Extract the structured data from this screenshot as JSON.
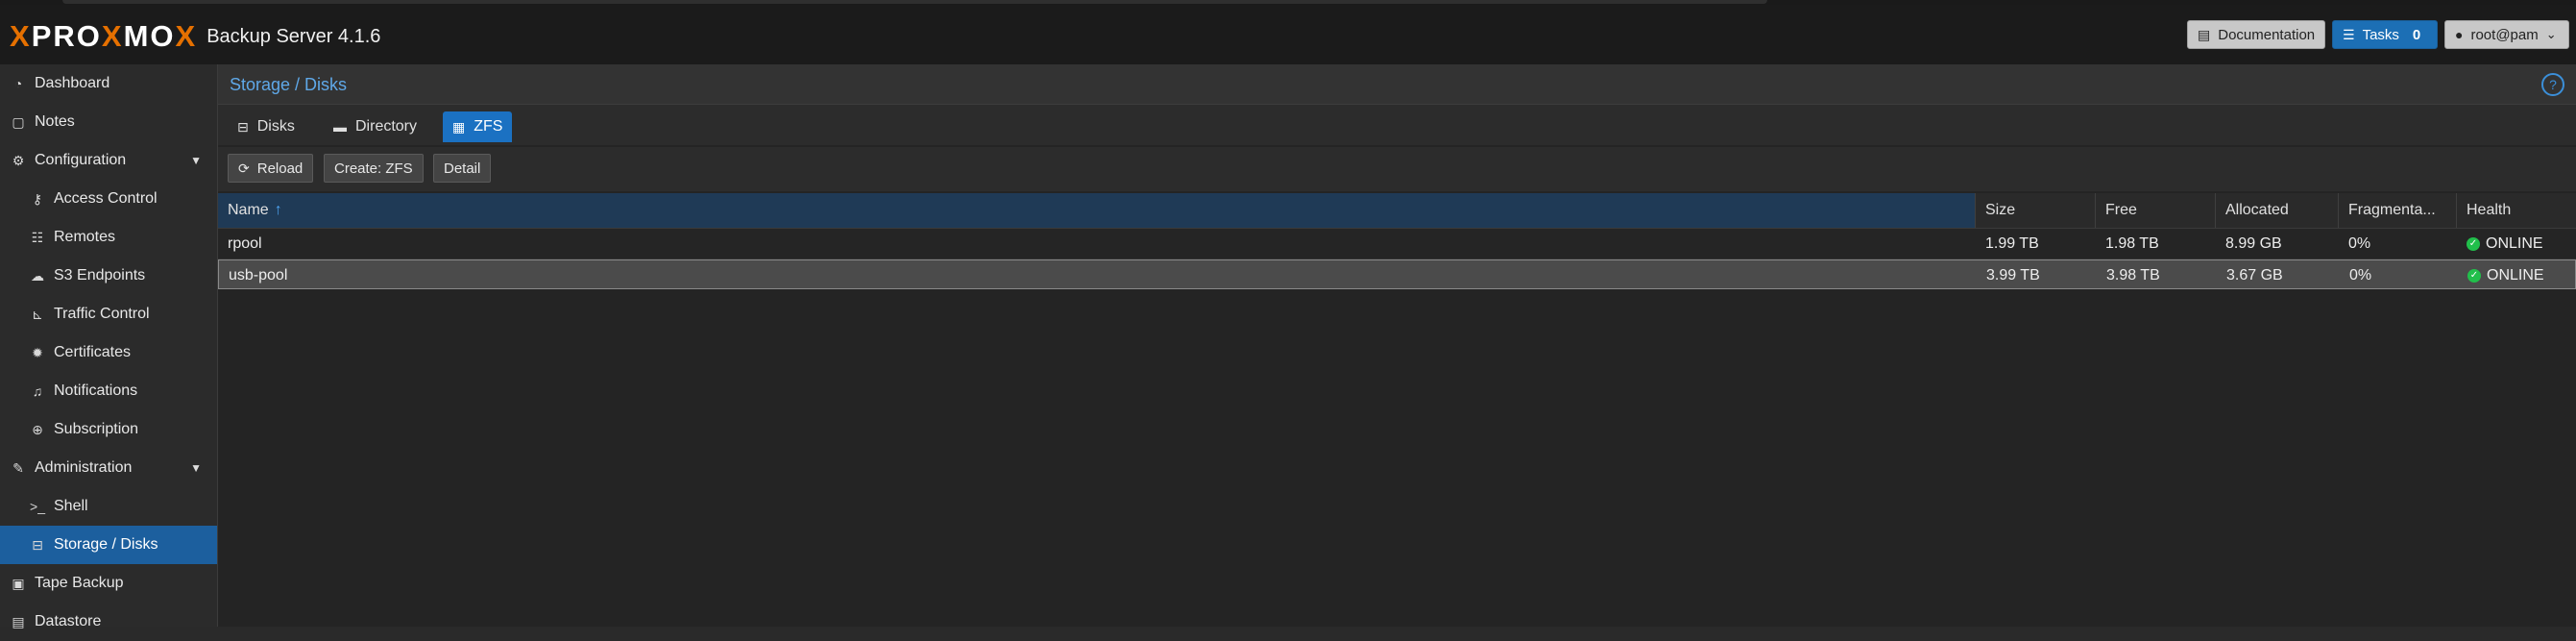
{
  "header": {
    "brand": "PROXMOX",
    "product": "Backup Server 4.1.6",
    "documentation_label": "Documentation",
    "tasks_label": "Tasks",
    "tasks_count": "0",
    "user_label": "root@pam"
  },
  "sidebar": {
    "items": [
      {
        "label": "Dashboard",
        "icon": "dashboard-icon"
      },
      {
        "label": "Notes",
        "icon": "notes-icon"
      },
      {
        "label": "Configuration",
        "icon": "gears-icon",
        "expanded": true
      },
      {
        "label": "Access Control",
        "icon": "key-icon"
      },
      {
        "label": "Remotes",
        "icon": "server-icon"
      },
      {
        "label": "S3 Endpoints",
        "icon": "cloud-upload-icon"
      },
      {
        "label": "Traffic Control",
        "icon": "chart-icon"
      },
      {
        "label": "Certificates",
        "icon": "certificate-icon"
      },
      {
        "label": "Notifications",
        "icon": "bell-icon"
      },
      {
        "label": "Subscription",
        "icon": "support-icon"
      },
      {
        "label": "Administration",
        "icon": "wrench-icon",
        "expanded": true
      },
      {
        "label": "Shell",
        "icon": "terminal-icon"
      },
      {
        "label": "Storage / Disks",
        "icon": "hdd-icon",
        "selected": true
      },
      {
        "label": "Tape Backup",
        "icon": "tape-icon"
      },
      {
        "label": "Datastore",
        "icon": "database-icon"
      }
    ]
  },
  "panel": {
    "title": "Storage / Disks",
    "help_icon": "help-icon"
  },
  "tabs": [
    {
      "label": "Disks",
      "icon": "hdd-icon"
    },
    {
      "label": "Directory",
      "icon": "folder-icon"
    },
    {
      "label": "ZFS",
      "icon": "grid-icon",
      "active": true
    }
  ],
  "toolbar": {
    "reload_label": "Reload",
    "create_label": "Create: ZFS",
    "detail_label": "Detail"
  },
  "grid": {
    "columns": [
      "Name",
      "Size",
      "Free",
      "Allocated",
      "Fragmenta...",
      "Health"
    ],
    "rows": [
      {
        "name": "rpool",
        "size": "1.99 TB",
        "free": "1.98 TB",
        "allocated": "8.99 GB",
        "frag": "0%",
        "health": "ONLINE"
      },
      {
        "name": "usb-pool",
        "size": "3.99 TB",
        "free": "3.98 TB",
        "allocated": "3.67 GB",
        "frag": "0%",
        "health": "ONLINE",
        "selected": true
      }
    ]
  },
  "colors": {
    "accent": "#1b71c2",
    "brand_orange": "#e57000",
    "online_green": "#21bf4b"
  }
}
